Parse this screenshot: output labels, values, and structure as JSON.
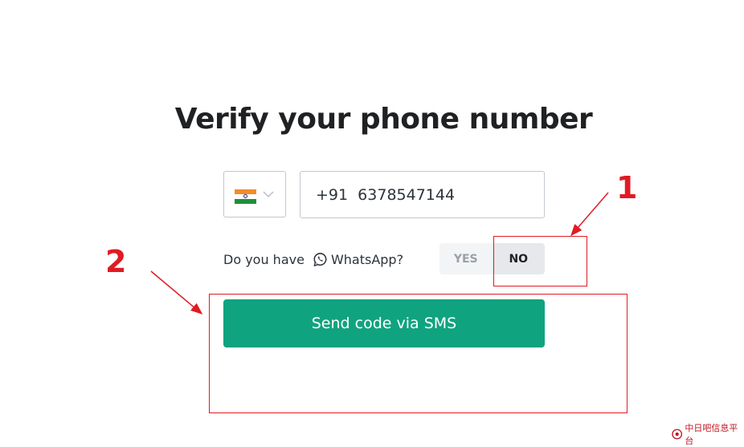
{
  "page": {
    "title": "Verify your phone number"
  },
  "phone": {
    "country_flag": "india-flag-icon",
    "value": "+91  6378547144"
  },
  "whatsapp": {
    "question_prefix": "Do you have",
    "question_app": "WhatsApp?",
    "yes_label": "YES",
    "no_label": "NO",
    "selected": "NO"
  },
  "submit": {
    "label": "Send code via SMS"
  },
  "annotations": {
    "marker_1": "1",
    "marker_2": "2"
  },
  "watermark": {
    "text": "中日吧信息平台"
  },
  "colors": {
    "primary": "#10a37f",
    "annotation": "#e01b24",
    "text": "#202123",
    "border": "#c2c8d0"
  }
}
